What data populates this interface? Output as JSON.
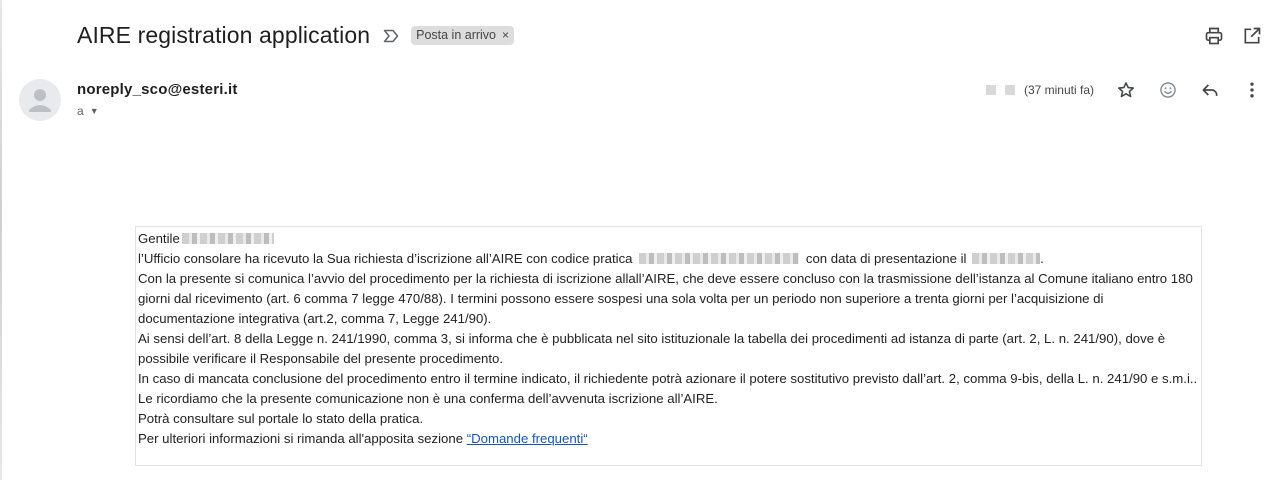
{
  "email": {
    "subject": "AIRE registration application",
    "label": "Posta in arrivo",
    "label_remove": "×",
    "sender": "noreply_sco@esteri.it",
    "recipient_prefix": "a",
    "time_ago": "(37 minuti fa)"
  },
  "icons": {
    "important": "important-marker-icon",
    "print": "print-icon",
    "open_new_window": "open-in-new-window-icon",
    "star": "star-icon",
    "emoji": "emoji-reaction-icon",
    "reply": "reply-icon",
    "more": "more-vert-icon",
    "avatar": "default-avatar-icon",
    "caret": "caret-down-icon"
  },
  "body": {
    "greeting": "Gentile",
    "line1_a": "l’Ufficio consolare ha ricevuto la Sua richiesta d’iscrizione all’AIRE con codice pratica",
    "line1_b": "con data di presentazione il",
    "line1_c": ".",
    "para2": "Con la presente si comunica l’avvio del procedimento per la richiesta di iscrizione allall’AIRE, che deve essere concluso con la trasmissione dell’istanza al Comune italiano entro 180 giorni dal ricevimento (art. 6 comma 7 legge 470/88). I termini possono essere sospesi una sola volta per un periodo non superiore a trenta giorni per l’acquisizione di documentazione integrativa (art.2, comma 7, Legge 241/90).",
    "para3": "Ai sensi dell’art. 8 della Legge n. 241/1990, comma 3, si informa che è pubblicata nel sito istituzionale la tabella dei procedimenti ad istanza di parte (art. 2, L. n. 241/90), dove è possibile verificare il Responsabile del presente procedimento.",
    "para4": "In caso di mancata conclusione del procedimento entro il termine indicato, il richiedente potrà azionare il potere sostitutivo previsto dall’art. 2, comma 9-bis, della L. n. 241/90 e s.m.i..",
    "para5": "Le ricordiamo che la presente comunicazione non è una conferma dell’avvenuta iscrizione all’AIRE.",
    "para6": "Potrà consultare sul portale lo stato della pratica.",
    "para7_text": "Per ulteriori informazioni si rimanda all'apposita sezione",
    "para7_link": "“Domande frequenti“"
  },
  "colors": {
    "link": "#1155cc",
    "chip_bg": "#dddddd",
    "text": "#202124"
  }
}
